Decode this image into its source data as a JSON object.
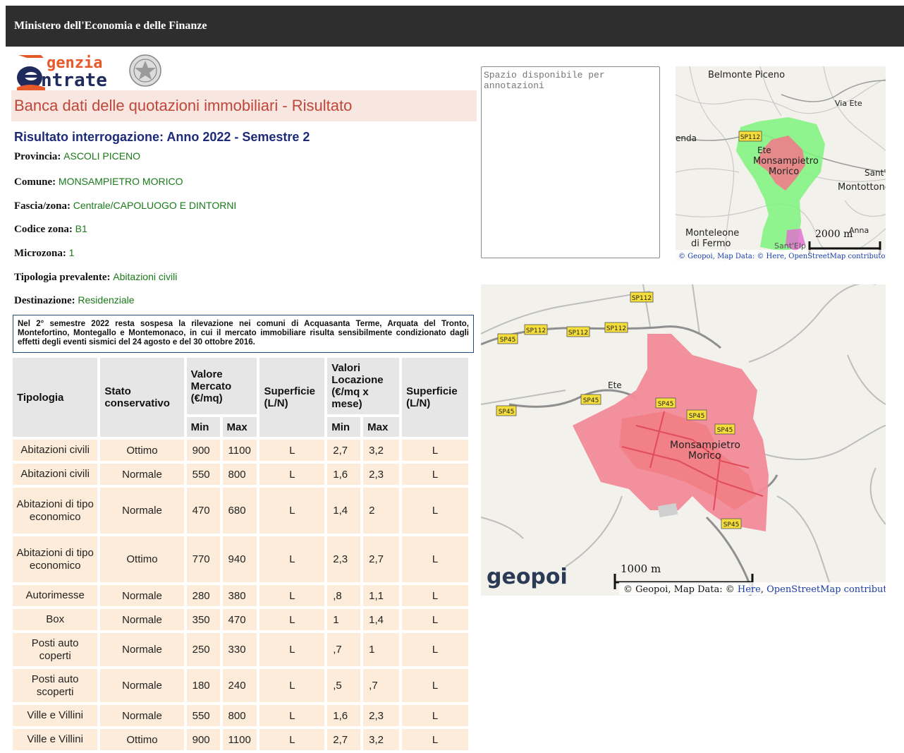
{
  "header": {
    "ministry": "Ministero dell'Economia e delle Finanze"
  },
  "logo": {
    "line1": "genzia",
    "line2": "ntrate"
  },
  "page": {
    "banner": "Banca dati delle quotazioni immobiliari - Risultato",
    "result_title": "Risultato interrogazione: Anno 2022 - Semestre 2"
  },
  "fields": {
    "provincia_label": "Provincia:",
    "provincia": "ASCOLI PICENO",
    "comune_label": "Comune:",
    "comune": "MONSAMPIETRO MORICO",
    "fascia_label": "Fascia/zona:",
    "fascia": "Centrale/CAPOLUOGO E DINTORNI",
    "codice_label": "Codice zona:",
    "codice": "B1",
    "microzona_label": "Microzona:",
    "microzona": "1",
    "tipologia_label": "Tipologia prevalente:",
    "tipologia": "Abitazioni civili",
    "destinazione_label": "Destinazione:",
    "destinazione": "Residenziale"
  },
  "notice": "Nel 2° semestre 2022 resta sospesa la rilevazione nei comuni di Acquasanta Terme, Arquata del Tronto, Montefortino, Montegallo e Montemonaco, in cui il mercato immobiliare risulta sensibilmente condizionato dagli effetti degli eventi sismici del 24 agosto e del 30 ottobre 2016.",
  "table": {
    "headers": {
      "tipologia": "Tipologia",
      "stato": "Stato conservativo",
      "valore": "Valore Mercato (€/mq)",
      "superficie1": "Superficie (L/N)",
      "locazione": "Valori Locazione (€/mq x mese)",
      "superficie2": "Superficie (L/N)",
      "min": "Min",
      "max": "Max"
    },
    "rows": [
      [
        "Abitazioni civili",
        "Ottimo",
        "900",
        "1100",
        "L",
        "2,7",
        "3,2",
        "L"
      ],
      [
        "Abitazioni civili",
        "Normale",
        "550",
        "800",
        "L",
        "1,6",
        "2,3",
        "L"
      ],
      [
        "Abitazioni di tipo economico",
        "Normale",
        "470",
        "680",
        "L",
        "1,4",
        "2",
        "L"
      ],
      [
        "Abitazioni di tipo economico",
        "Ottimo",
        "770",
        "940",
        "L",
        "2,3",
        "2,7",
        "L"
      ],
      [
        "Autorimesse",
        "Normale",
        "280",
        "380",
        "L",
        ",8",
        "1,1",
        "L"
      ],
      [
        "Box",
        "Normale",
        "350",
        "470",
        "L",
        "1",
        "1,4",
        "L"
      ],
      [
        "Posti auto coperti",
        "Normale",
        "250",
        "330",
        "L",
        ",7",
        "1",
        "L"
      ],
      [
        "Posti auto scoperti",
        "Normale",
        "180",
        "240",
        "L",
        ",5",
        ",7",
        "L"
      ],
      [
        "Ville e Villini",
        "Normale",
        "550",
        "800",
        "L",
        "1,6",
        "2,3",
        "L"
      ],
      [
        "Ville e Villini",
        "Ottimo",
        "900",
        "1100",
        "L",
        "2,7",
        "3,2",
        "L"
      ]
    ]
  },
  "annotations": {
    "placeholder": "Spazio disponibile per annotazioni"
  },
  "map_small": {
    "labels": {
      "belmonte": "Belmonte Piceno",
      "via_ete": "Via Ete",
      "enda": "enda",
      "sp112": "SP112",
      "ete": "Ete",
      "monsampietro": "Monsampietro",
      "morico": "Morico",
      "sant": "Sant'",
      "montottone": "Montottone",
      "monteleone": "Monteleone",
      "di_fermo": "di Fermo",
      "santelp": "Sant'Elp",
      "anna": "Anna"
    },
    "scale": "2000 m",
    "attribution": "© Geopoi, Map Data: © Here, OpenStreetMap contributors"
  },
  "map_big": {
    "labels": {
      "ete": "Ete",
      "monsampietro": "Monsampietro",
      "morico": "Morico",
      "sp112": "SP112",
      "sp45": "SP45"
    },
    "logo_text": "geopoi",
    "scale": "1000 m",
    "attribution_prefix": "© Geopoi, Map Data: © ",
    "here_link": "Here",
    "osm_link": "OpenStreetMap contributors"
  }
}
